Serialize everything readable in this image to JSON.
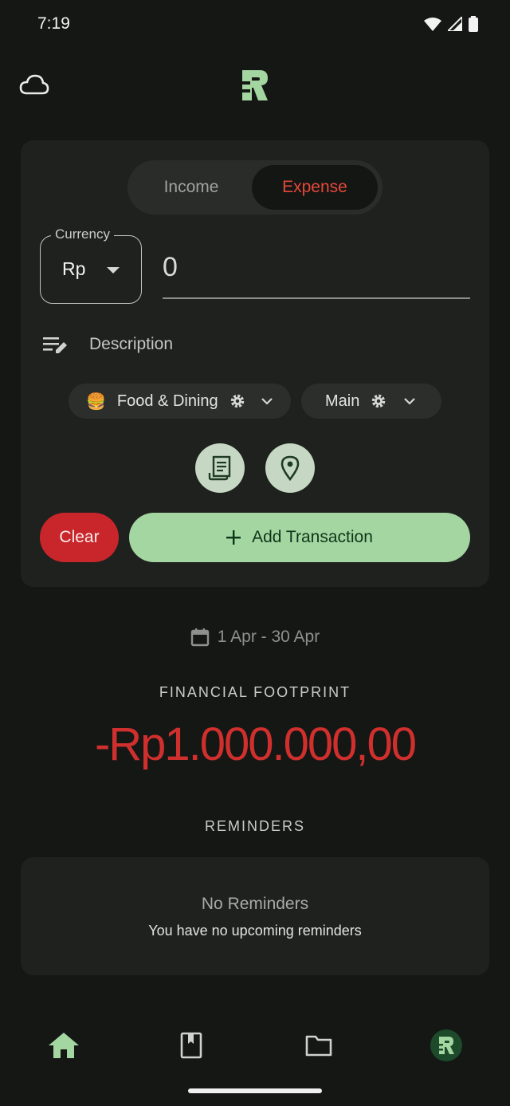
{
  "status": {
    "time": "7:19"
  },
  "toggle": {
    "income": "Income",
    "expense": "Expense"
  },
  "currency": {
    "label": "Currency",
    "value": "Rp"
  },
  "amount": {
    "value": "0"
  },
  "description": {
    "placeholder": "Description"
  },
  "chips": {
    "category": "Food & Dining",
    "category_emoji": "🍔",
    "account": "Main"
  },
  "actions": {
    "clear": "Clear",
    "add": "Add Transaction"
  },
  "period": {
    "range": "1 Apr - 30 Apr"
  },
  "footprint": {
    "title": "FINANCIAL FOOTPRINT",
    "value": "-Rp1.000.000,00"
  },
  "reminders": {
    "title": "REMINDERS",
    "empty_title": "No Reminders",
    "empty_subtitle": "You have no upcoming reminders"
  },
  "colors": {
    "expense": "#e5483b",
    "accent": "#a3d6a0",
    "clear": "#c8262a",
    "negative": "#d0302d"
  }
}
